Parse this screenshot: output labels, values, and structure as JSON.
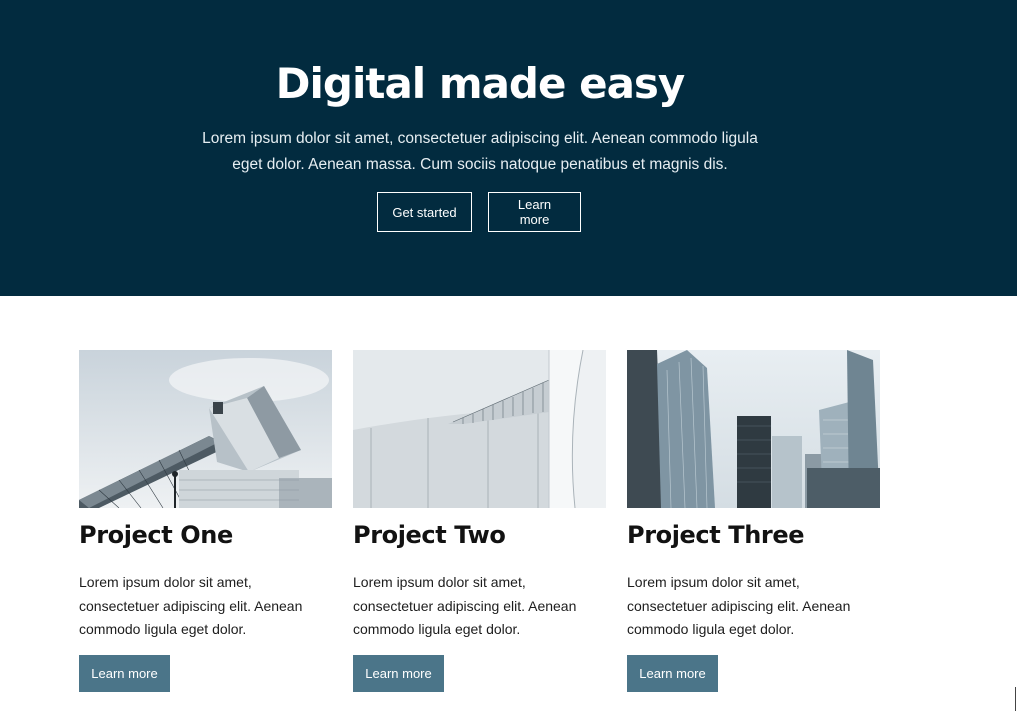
{
  "hero": {
    "title": "Digital made easy",
    "text": "Lorem ipsum dolor sit amet, consectetuer adipiscing elit. Aenean commodo ligula eget dolor. Aenean massa. Cum sociis natoque penatibus et magnis dis.",
    "primary_button": "Get started",
    "secondary_button": "Learn more"
  },
  "projects": [
    {
      "title": "Project One",
      "text": "Lorem ipsum dolor sit amet, consectetuer adipiscing elit. Aenean commodo ligula eget dolor.",
      "button": "Learn more"
    },
    {
      "title": "Project Two",
      "text": "Lorem ipsum dolor sit amet, consectetuer adipiscing elit. Aenean commodo ligula eget dolor.",
      "button": "Learn more"
    },
    {
      "title": "Project Three",
      "text": "Lorem ipsum dolor sit amet, consectetuer adipiscing elit. Aenean commodo ligula eget dolor.",
      "button": "Learn more"
    }
  ],
  "colors": {
    "hero_background": "#022b3f",
    "button_background": "#4b7589"
  }
}
